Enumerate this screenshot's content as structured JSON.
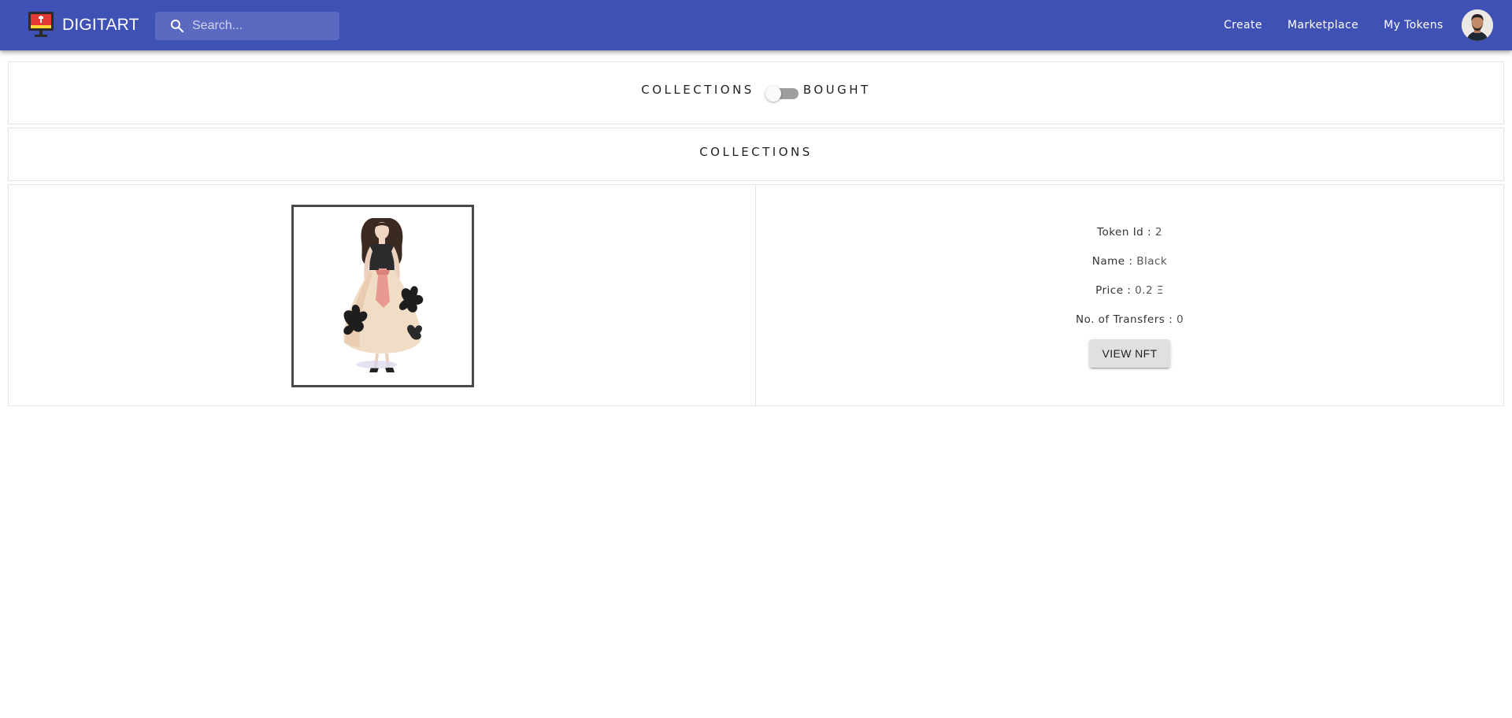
{
  "appbar": {
    "brand_name": "DIGITART",
    "logo_icon": "monitor-logo-icon",
    "search": {
      "placeholder": "Search...",
      "value": "",
      "icon": "search-icon"
    },
    "nav": [
      "Create",
      "Marketplace",
      "My Tokens"
    ],
    "avatar_icon": "user-avatar",
    "colors": {
      "background": "#3f51b5",
      "text": "#ffffff"
    }
  },
  "view_toggle": {
    "left_label": "COLLECTIONS",
    "right_label": "BOUGHT",
    "checked": false
  },
  "section_heading": "COLLECTIONS",
  "nft": {
    "image_icon": "fashion-illustration-image",
    "token_id_label": "Token Id :",
    "token_id": "2",
    "name_label": "Name :",
    "name": "Black",
    "price_label": "Price :",
    "price": "0.2 Ξ",
    "transfers_label": "No. of Transfers :",
    "transfers": "0",
    "view_button": "VIEW NFT"
  }
}
